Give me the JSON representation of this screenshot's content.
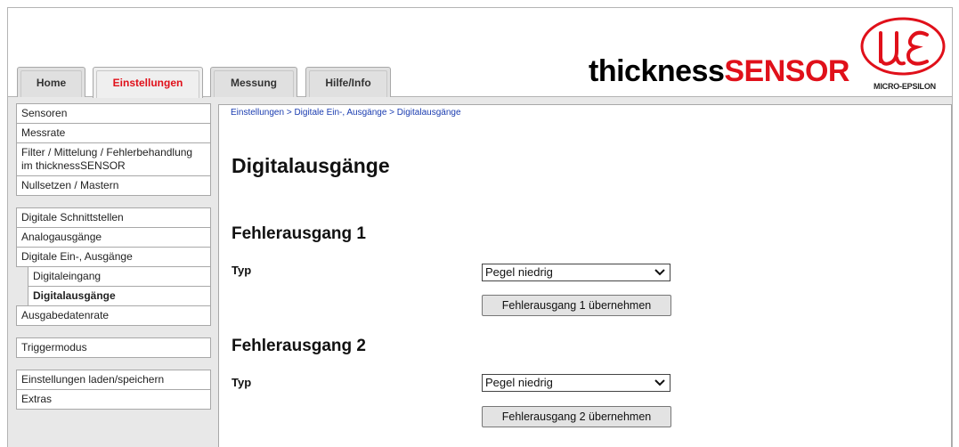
{
  "tabs": [
    {
      "label": "Home"
    },
    {
      "label": "Einstellungen"
    },
    {
      "label": "Messung"
    },
    {
      "label": "Hilfe/Info"
    }
  ],
  "brand": {
    "part1": "thickness",
    "part2": "SENSOR"
  },
  "logo": {
    "text": "MICRO-EPSILON"
  },
  "sidebar": {
    "items": [
      "Sensoren",
      "Messrate",
      "Filter / Mittelung / Fehlerbehandlung im thicknessSENSOR",
      "Nullsetzen / Mastern",
      "Digitale Schnittstellen",
      "Analogausgänge",
      "Digitale Ein-, Ausgänge",
      "Digitaleingang",
      "Digitalausgänge",
      "Ausgabedatenrate",
      "Triggermodus",
      "Einstellungen laden/speichern",
      "Extras"
    ]
  },
  "main": {
    "breadcrumb": "Einstellungen > Digitale Ein-, Ausgänge > Digitalausgänge",
    "title": "Digitalausgänge",
    "section1": {
      "heading": "Fehlerausgang 1",
      "label": "Typ",
      "value": "Pegel niedrig",
      "button": "Fehlerausgang 1 übernehmen"
    },
    "section2": {
      "heading": "Fehlerausgang 2",
      "label": "Typ",
      "value": "Pegel niedrig",
      "button": "Fehlerausgang 2 übernehmen"
    }
  },
  "colors": {
    "accent": "#e0101a",
    "link": "#1a3cb0"
  }
}
